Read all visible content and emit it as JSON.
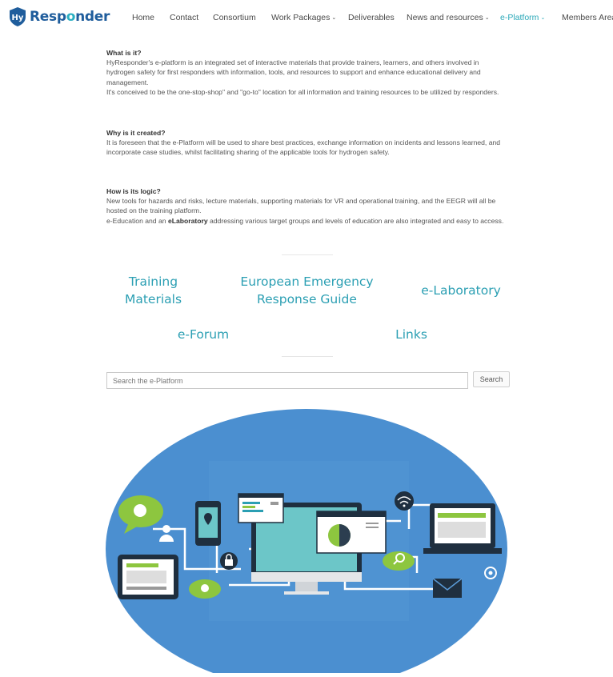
{
  "brand": {
    "logo_hy": "Hy",
    "logo_text_1": "Resp",
    "logo_text_o": "o",
    "logo_text_2": "nder"
  },
  "nav": {
    "home": "Home",
    "contact": "Contact",
    "consortium": "Consortium",
    "work_packages": "Work Packages",
    "deliverables": "Deliverables",
    "news": "News and resources",
    "eplatform": "e-Platform",
    "members": "Members Area"
  },
  "sections": {
    "what_title": "What is it?",
    "what_p1": "HyResponder's e-platform is an integrated set of interactive materials that provide trainers, learners, and others involved in hydrogen safety for first responders with information, tools, and resources to support and enhance educational delivery and management.",
    "what_p2": "It's conceived to be the one-stop-shop\" and \"go-to\" location for all information and training resources to be utilized by responders.",
    "why_title": "Why is it created?",
    "why_p1": "It is foreseen that the e-Platform will be used to share best practices, exchange information on incidents and lessons learned, and incorporate case studies, whilst facilitating sharing of the applicable tools for hydrogen safety.",
    "how_title": "How is its logic?",
    "how_p1": "New tools for hazards and risks, lecture materials, supporting materials for VR and operational training, and the EEGR will all be hosted on the training platform.",
    "how_p2_a": "e-Education and an ",
    "how_p2_bold": "eLaboratory",
    "how_p2_b": " addressing various target groups and levels of education are also integrated and easy to access."
  },
  "links": {
    "training_1": "Training",
    "training_2": "Materials",
    "eegr_1": "European Emergency",
    "eegr_2": "Response Guide",
    "elab": "e-Laboratory",
    "forum": "e-Forum",
    "links": "Links"
  },
  "search": {
    "placeholder": "Search the e-Platform",
    "button": "Search"
  },
  "colors": {
    "brand": "#1f5d9c",
    "accent": "#2aa8b8",
    "hero_bg": "#4b8fd0"
  }
}
